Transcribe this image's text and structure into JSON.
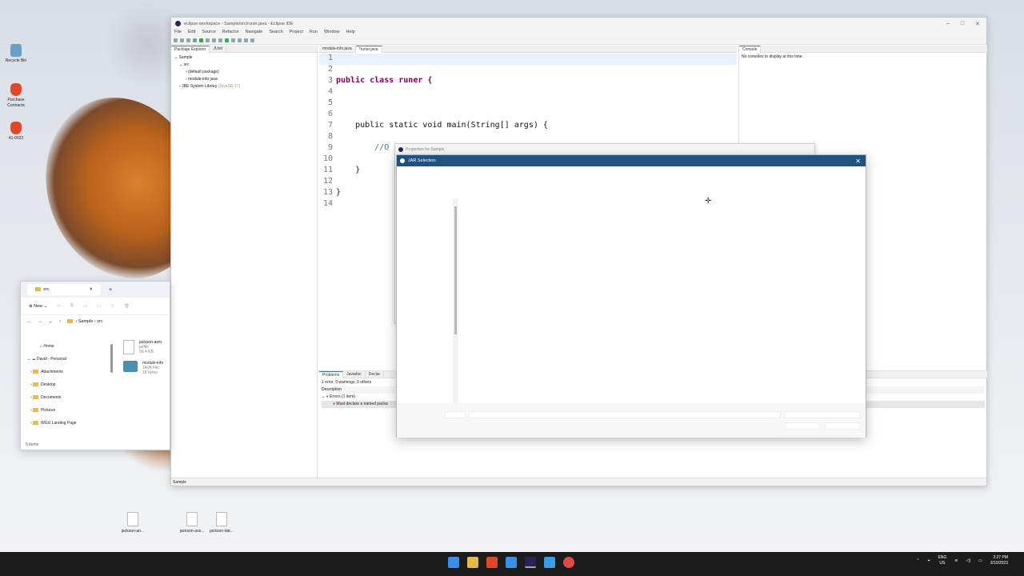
{
  "desktop": {
    "icons": [
      {
        "label": "Recycle Bin",
        "icon": "recycle-bin-icon",
        "color": "#6aa0c8"
      },
      {
        "label": "Purchase Contracts",
        "icon": "brave-icon",
        "color": "#e2462c"
      },
      {
        "label": "41-0022",
        "icon": "brave-icon",
        "color": "#e2462c"
      }
    ],
    "bottom_files": [
      "jackson-an...",
      "jackson-ass...",
      "jackson-dat..."
    ]
  },
  "eclipse": {
    "title": "eclipse-workspace - Sample/src/runer.java - Eclipse IDE",
    "menu": [
      "File",
      "Edit",
      "Source",
      "Refactor",
      "Navigate",
      "Search",
      "Project",
      "Run",
      "Window",
      "Help"
    ],
    "package_tabs": [
      "Package Explorer",
      "JUnit"
    ],
    "tree": {
      "project": "Sample",
      "src": "src",
      "default_package": "(default package)",
      "module_info": "module-info.java",
      "jre": "JRE System Library",
      "jre_version": "[JavaSE-17]"
    },
    "editor_tabs": [
      "module-info.java",
      "*runer.java"
    ],
    "code_lines": [
      {
        "n": "1",
        "text": ""
      },
      {
        "n": "2",
        "text": ""
      },
      {
        "n": "3",
        "text": "public class runer {"
      },
      {
        "n": "4",
        "text": ""
      },
      {
        "n": "5",
        "text": ""
      },
      {
        "n": "6",
        "text": ""
      },
      {
        "n": "7",
        "text": "    public static void main(String[] args) {"
      },
      {
        "n": "8",
        "text": ""
      },
      {
        "n": "9",
        "text": "        //O"
      },
      {
        "n": "10",
        "text": ""
      },
      {
        "n": "11",
        "text": "    }"
      },
      {
        "n": "12",
        "text": ""
      },
      {
        "n": "13",
        "text": "}"
      },
      {
        "n": "14",
        "text": ""
      }
    ],
    "console_tab": "Console",
    "console_message": "No consoles to display at this time.",
    "bottom_tabs": [
      "Problems",
      "Javadoc",
      "Declar"
    ],
    "problems_summary": "1 error, 0 warnings, 0 others",
    "problems_header": "Description",
    "errors_group": "Errors (1 item)",
    "error_item": "Must declare a named packa",
    "status": "Sample"
  },
  "properties_dialog": {
    "title": "Properties for Sample"
  },
  "jar_dialog": {
    "title": "JAR Selection",
    "close": "✕"
  },
  "explorer": {
    "tab": "src",
    "new_label": "New",
    "path": [
      "Sample",
      "src"
    ],
    "nav": [
      "Home",
      "David - Personal",
      "Attachments",
      "Desktop",
      "Documents",
      "Pictures",
      "WGU Landing Page"
    ],
    "files": [
      {
        "name": "jackson-asm",
        "type": "jarfile",
        "size": "66.4 KB"
      },
      {
        "name": "module-info",
        "type": "JAVA File",
        "size": "18 bytes"
      }
    ],
    "status": "5 items"
  },
  "taskbar": {
    "lang": "ENG",
    "region": "US",
    "time": "2:27 PM",
    "date": "3/10/2023"
  }
}
